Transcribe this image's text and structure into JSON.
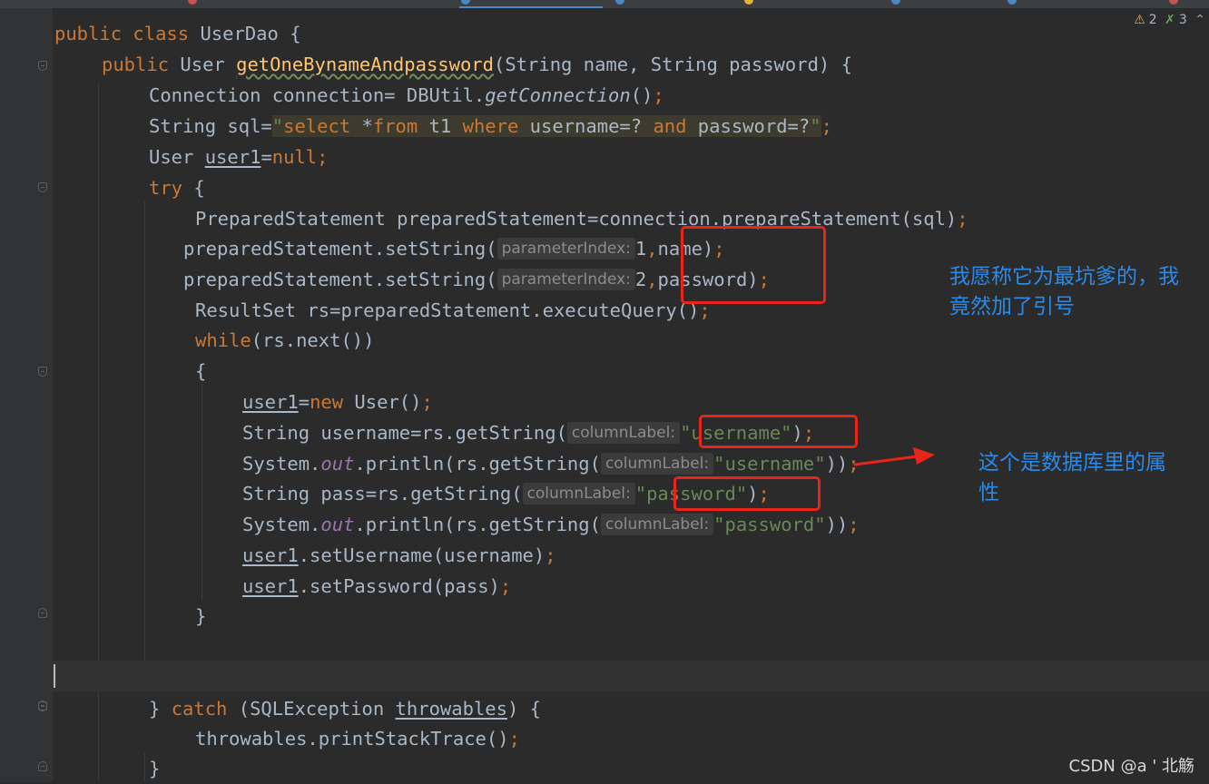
{
  "inspections": {
    "warnings": "2",
    "weak_warnings": "3"
  },
  "code": {
    "l1": {
      "kw1": "public",
      "kw2": "class",
      "name": "UserDao",
      "brace": " {"
    },
    "l2": {
      "kw1": "public",
      "type": "User",
      "method": "getOneBynameAndpassword",
      "params": "(String name, String password) {"
    },
    "l3": {
      "a": "Connection connection= DBUtil.",
      "m": "getConnection",
      "b": "()",
      "semi": ";"
    },
    "l4": {
      "a": "String sql=",
      "q1": "\"",
      "s1": "select",
      "s2": " *",
      "s3": "from",
      "s4": " t1 ",
      "s5": "where",
      "s6": " username=? ",
      "s7": "and",
      "s8": " password=?",
      "q2": "\"",
      "semi": ";"
    },
    "l5": {
      "type": "User ",
      "var": "user1",
      "eq": "=",
      "null": "null",
      "semi": ";"
    },
    "l6": {
      "kw": "try",
      "brace": " {"
    },
    "l7": {
      "text": "PreparedStatement preparedStatement=connection.prepareStatement(sql)",
      "semi": ";"
    },
    "l8": {
      "a": "preparedStatement.setString(",
      "hint": "parameterIndex:",
      "num": "1",
      "comma": ",",
      "b": "name)",
      "semi": ";"
    },
    "l9": {
      "a": "preparedStatement.setString(",
      "hint": "parameterIndex:",
      "num": "2",
      "comma": ",",
      "b": "password)",
      "semi": ";"
    },
    "l10": {
      "text": "ResultSet rs=preparedStatement.executeQuery()",
      "semi": ";"
    },
    "l11": {
      "kw": "while",
      "text": "(rs.next())"
    },
    "l12": {
      "text": "{"
    },
    "l13": {
      "var": "user1",
      "eq": "=",
      "kw": "new",
      "rest": " User()",
      "semi": ";"
    },
    "l14": {
      "a": "String username=rs.getString(",
      "hint": "columnLabel:",
      "str": "\"username\"",
      "b": ")",
      "semi": ";"
    },
    "l15": {
      "a": "System.",
      "field": "out",
      "b": ".println(rs.getString(",
      "hint": "columnLabel:",
      "str": "\"username\"",
      "c": "))",
      "semi": ";"
    },
    "l16": {
      "a": "String pass=rs.getString(",
      "hint": "columnLabel:",
      "str": "\"password\"",
      "b": ")",
      "semi": ";"
    },
    "l17": {
      "a": "System.",
      "field": "out",
      "b": ".println(rs.getString(",
      "hint": "columnLabel:",
      "str": "\"password\"",
      "c": "))",
      "semi": ";"
    },
    "l18": {
      "var": "user1",
      "rest": ".setUsername(username)",
      "semi": ";"
    },
    "l19": {
      "var": "user1",
      "rest": ".setPassword(pass)",
      "semi": ";"
    },
    "l20": {
      "text": "}"
    },
    "l22": {
      "a": "} ",
      "kw": "catch",
      "b": " (SQLException ",
      "var": "throwables",
      "c": ") {"
    },
    "l23": {
      "text": "throwables.printStackTrace()",
      "semi": ";"
    },
    "l24": {
      "text": "}"
    }
  },
  "annotations": {
    "note1_line1": "我愿称它为最坑爹的，我",
    "note1_line2": "竟然加了引号",
    "note2_line1": "这个是数据库里的属",
    "note2_line2": "性"
  },
  "watermark": "CSDN @a '    北觞",
  "colors": {
    "background": "#2b2b2b",
    "keyword": "#cc7832",
    "method_decl": "#ffc66d",
    "string": "#6a8759",
    "static_field": "#9876aa",
    "text": "#a9b7c6",
    "annotation_box": "#e8251a",
    "annotation_text": "#2b8ae8"
  }
}
